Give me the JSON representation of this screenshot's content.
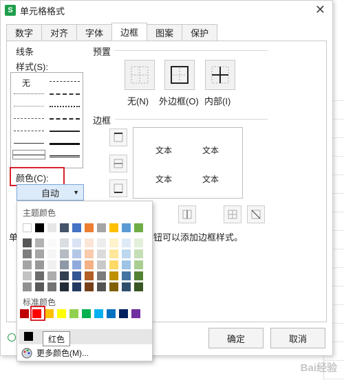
{
  "dialog": {
    "title": "单元格格式",
    "tabs": [
      "数字",
      "对齐",
      "字体",
      "边框",
      "图案",
      "保护"
    ],
    "active_tab": "边框"
  },
  "line": {
    "section": "线条",
    "style_label": "样式(S):",
    "none_label": "无",
    "color_label": "颜色(C):",
    "color_value": "自动"
  },
  "presets": {
    "section": "预置",
    "items": [
      "无(N)",
      "外边框(O)",
      "内部(I)"
    ]
  },
  "border": {
    "section": "边框",
    "preview_text": [
      "文本",
      "文本",
      "文本",
      "文本"
    ],
    "hint_fragment": "单",
    "hint_tail": "钮可以添加边框样式。"
  },
  "palette": {
    "theme_label": "主题颜色",
    "standard_label": "标准颜色",
    "more_label": "更多颜色(M)...",
    "theme_top": [
      "#ffffff",
      "#000000",
      "#e7e6e6",
      "#44546a",
      "#4472c4",
      "#ed7d31",
      "#a5a5a5",
      "#ffc000",
      "#5b9bd5",
      "#70ad47"
    ],
    "standard": [
      "#c00000",
      "#ff0000",
      "#ffc000",
      "#ffff00",
      "#92d050",
      "#00b050",
      "#00b0f0",
      "#0070c0",
      "#002060",
      "#7030a0"
    ],
    "recent": [
      "#000000"
    ]
  },
  "buttons": {
    "ok": "确定",
    "cancel": "取消"
  },
  "tooltip": "红色",
  "watermark": "Bai经验"
}
